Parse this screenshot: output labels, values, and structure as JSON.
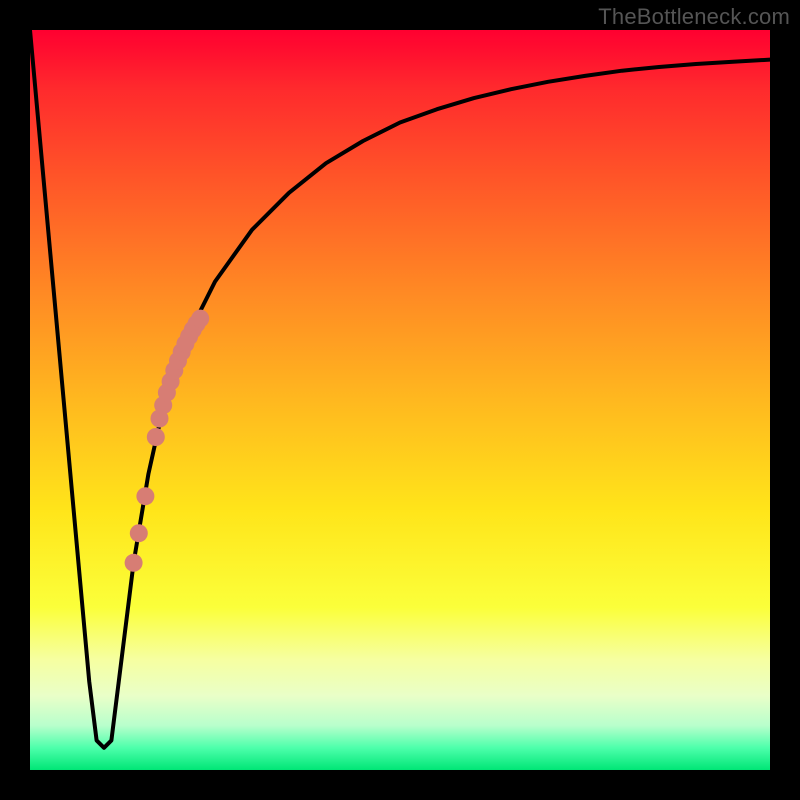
{
  "watermark": "TheBottleneck.com",
  "colors": {
    "frame": "#000000",
    "curve": "#000000",
    "marker": "#d77d74",
    "gradient_stops": [
      "#ff0030",
      "#ff2a2d",
      "#ff5528",
      "#ff8824",
      "#ffb81f",
      "#ffe51a",
      "#fbff3a",
      "#f6ffa0",
      "#e9ffc8",
      "#b8ffcc",
      "#4dffab",
      "#00e676"
    ]
  },
  "chart_data": {
    "type": "line",
    "title": "",
    "xlabel": "",
    "ylabel": "",
    "xlim": [
      0,
      100
    ],
    "ylim": [
      0,
      100
    ],
    "grid": false,
    "series": [
      {
        "name": "bottleneck-curve",
        "x": [
          0,
          2,
          4,
          6,
          8,
          9,
          10,
          11,
          12,
          14,
          16,
          18,
          20,
          22,
          25,
          30,
          35,
          40,
          45,
          50,
          55,
          60,
          65,
          70,
          75,
          80,
          85,
          90,
          95,
          100
        ],
        "values": [
          100,
          78,
          56,
          34,
          12,
          4,
          3,
          4,
          12,
          28,
          40,
          49,
          55,
          60,
          66,
          73,
          78,
          82,
          85,
          87.5,
          89.3,
          90.8,
          92,
          93,
          93.8,
          94.5,
          95,
          95.4,
          95.7,
          96
        ]
      }
    ],
    "markers": {
      "name": "highlighted-segment",
      "type": "circle",
      "radius_px": 9,
      "points": [
        {
          "x": 14.0,
          "y": 28
        },
        {
          "x": 14.7,
          "y": 32
        },
        {
          "x": 15.6,
          "y": 37
        },
        {
          "x": 17.0,
          "y": 45
        },
        {
          "x": 17.5,
          "y": 47.5
        },
        {
          "x": 18.0,
          "y": 49.3
        },
        {
          "x": 18.5,
          "y": 51.0
        },
        {
          "x": 19.0,
          "y": 52.5
        },
        {
          "x": 19.5,
          "y": 54.0
        },
        {
          "x": 20.0,
          "y": 55.3
        },
        {
          "x": 20.5,
          "y": 56.5
        },
        {
          "x": 21.0,
          "y": 57.6
        },
        {
          "x": 21.5,
          "y": 58.6
        },
        {
          "x": 22.0,
          "y": 59.5
        },
        {
          "x": 22.5,
          "y": 60.3
        },
        {
          "x": 23.0,
          "y": 61.0
        }
      ]
    }
  }
}
